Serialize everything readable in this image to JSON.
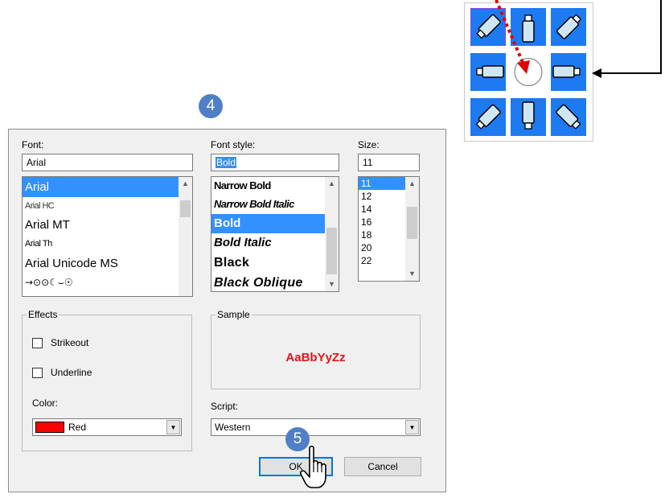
{
  "dialog": {
    "font": {
      "label": "Font:",
      "value": "Arial",
      "items": [
        "Arial",
        "Arial HC",
        "Arial MT",
        "Arial Th",
        "Arial Unicode MS",
        "→⊙⊙☾⌣☉"
      ]
    },
    "font_style": {
      "label": "Font style:",
      "value": "Bold",
      "items": [
        "Narrow Bold",
        "Narrow Bold Italic",
        "Bold",
        "Bold Italic",
        "Black",
        "Black Oblique"
      ]
    },
    "size": {
      "label": "Size:",
      "value": "11",
      "items": [
        "11",
        "12",
        "14",
        "16",
        "18",
        "20",
        "22"
      ]
    },
    "effects": {
      "title": "Effects",
      "strikeout_label": "Strikeout",
      "strikeout_checked": false,
      "underline_label": "Underline",
      "underline_checked": false,
      "color_label": "Color:",
      "color_value": "Red",
      "color_swatch": "#ff0000"
    },
    "sample": {
      "title": "Sample",
      "text": "AaBbYyZz",
      "color": "#e0141e"
    },
    "script": {
      "label": "Script:",
      "value": "Western"
    },
    "ok_label": "OK",
    "cancel_label": "Cancel"
  },
  "callouts": {
    "step_4": "4",
    "step_5": "5"
  },
  "compass": {
    "cells": [
      "north-west",
      "north",
      "north-east",
      "west",
      "center",
      "east",
      "south-west",
      "south",
      "south-east"
    ],
    "selected": "north-west",
    "accent": "#1e7af0"
  }
}
